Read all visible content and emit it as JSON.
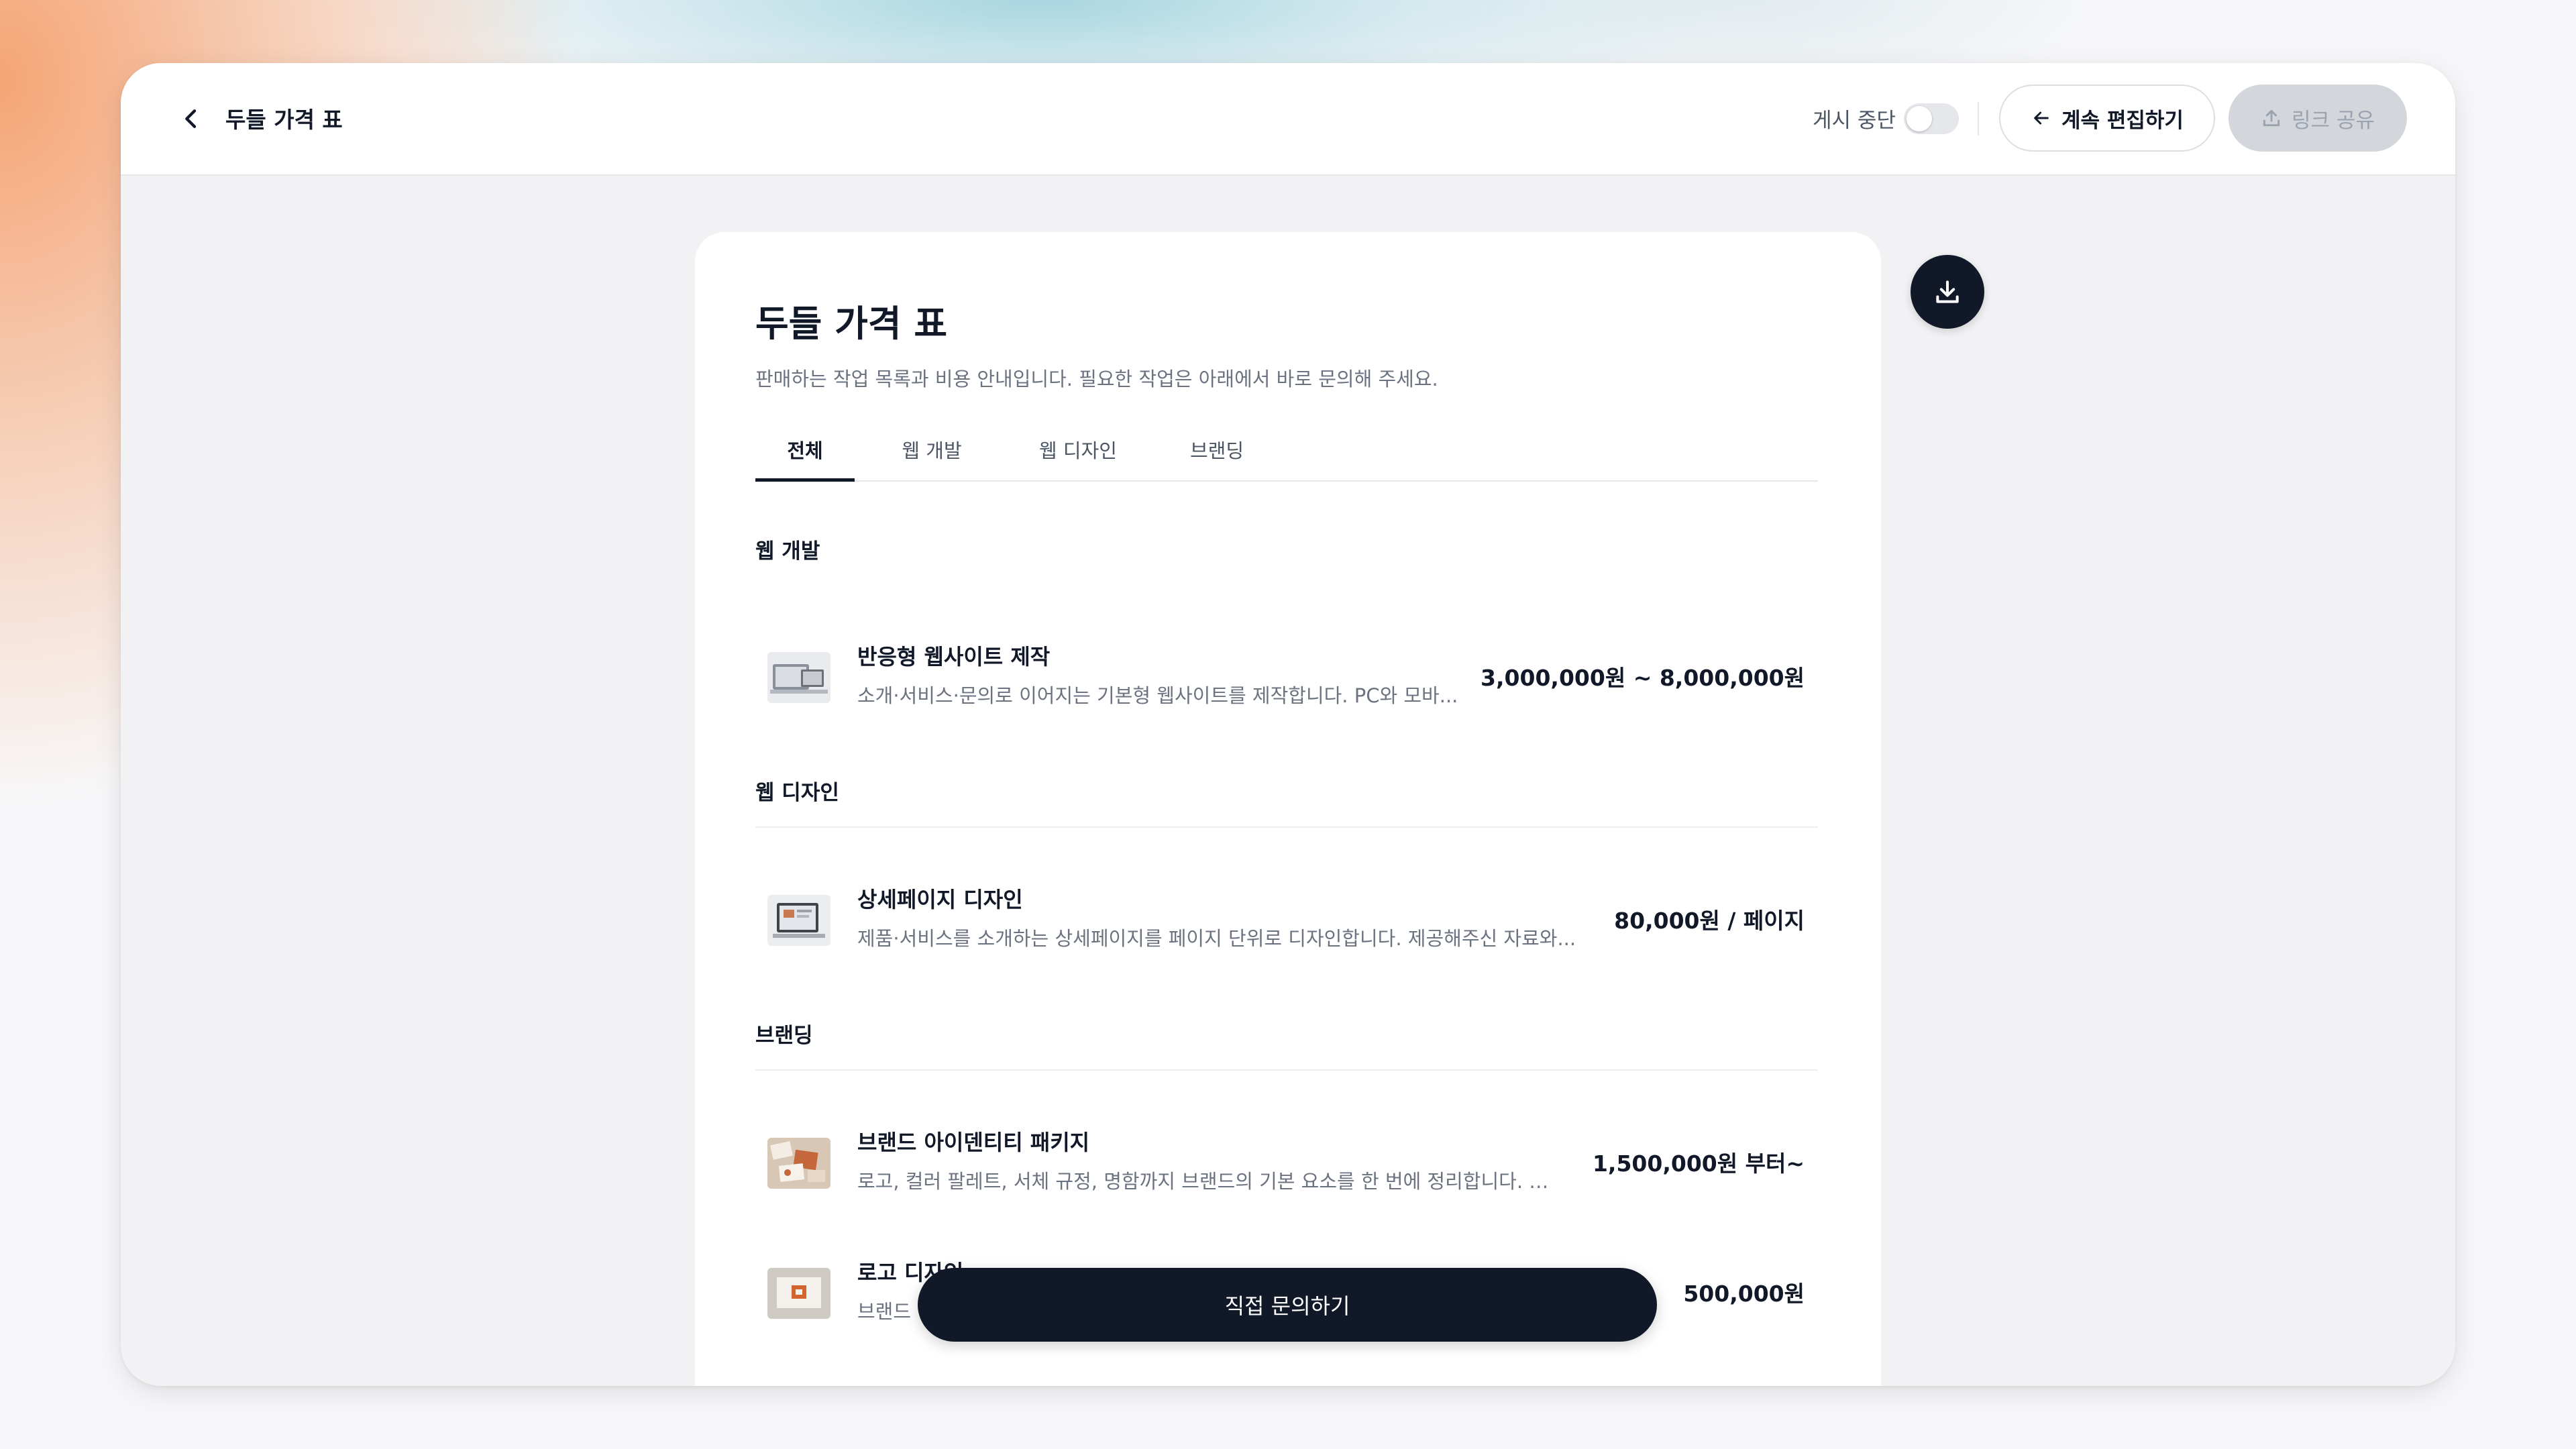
{
  "header": {
    "title": "두들 가격 표",
    "pause_label": "게시 중단",
    "pause_enabled": false,
    "edit_label": "계속 편집하기",
    "share_label": "링크 공유"
  },
  "document": {
    "title": "두들 가격 표",
    "subtitle": "판매하는 작업 목록과 비용 안내입니다. 필요한 작업은 아래에서 바로 문의해 주세요.",
    "tabs": [
      {
        "label": "전체",
        "active": true
      },
      {
        "label": "웹 개발",
        "active": false
      },
      {
        "label": "웹 디자인",
        "active": false
      },
      {
        "label": "브랜딩",
        "active": false
      }
    ],
    "sections": [
      {
        "title": "웹 개발",
        "items": [
          {
            "title": "반응형 웹사이트 제작",
            "description": "소개·서비스·문의로 이어지는 기본형 웹사이트를 제작합니다. PC와 모바...",
            "price": "3,000,000원 ~ 8,000,000원"
          }
        ]
      },
      {
        "title": "웹 디자인",
        "items": [
          {
            "title": "상세페이지 디자인",
            "description": "제품·서비스를 소개하는 상세페이지를 페이지 단위로 디자인합니다. 제공해주신 자료와...",
            "price": "80,000원 / 페이지"
          }
        ]
      },
      {
        "title": "브랜딩",
        "items": [
          {
            "title": "브랜드 아이덴티티 패키지",
            "description": "로고, 컬러 팔레트, 서체 규정, 명함까지 브랜드의 기본 요소를 한 번에 정리합니다. 브...",
            "price": "1,500,000원 부터~"
          },
          {
            "title": "로고 디자인",
            "description": "브랜드",
            "price": "500,000원"
          }
        ]
      }
    ]
  },
  "cta_label": "직접 문의하기",
  "icons": {
    "back": "chevron-left-icon",
    "edit": "arrow-left-icon",
    "share": "upload-icon",
    "download": "download-icon"
  },
  "colors": {
    "primary": "#111827",
    "muted_text": "#6b7280",
    "disabled_button": "#d3d6db"
  }
}
